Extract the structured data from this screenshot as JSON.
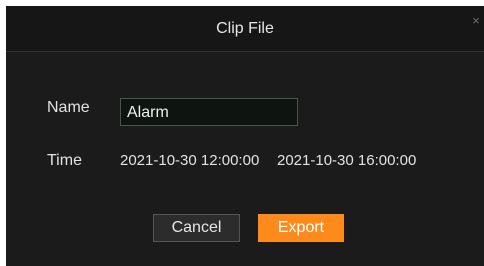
{
  "dialog": {
    "title": "Clip File",
    "close_glyph": "×",
    "close_icon": "close-icon"
  },
  "form": {
    "name_label": "Name",
    "name_value": "Alarm",
    "time_label": "Time",
    "time_start": "2021-10-30 12:00:00",
    "time_end": "2021-10-30 16:00:00"
  },
  "buttons": {
    "cancel_label": "Cancel",
    "export_label": "Export"
  },
  "colors": {
    "dialog_background": "#1b1b1b",
    "accent": "#ff8a1c"
  }
}
